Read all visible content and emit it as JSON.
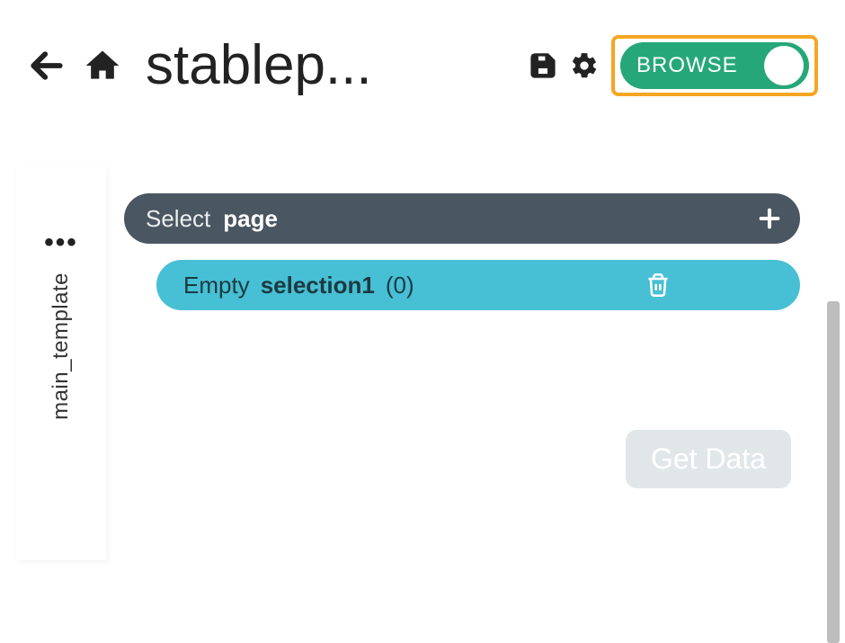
{
  "header": {
    "title": "stablep...",
    "toggle_label": "BROWSE"
  },
  "sidebar": {
    "tab_label": "main_template"
  },
  "rows": {
    "select": {
      "prefix": "Select",
      "target": "page"
    },
    "selection": {
      "status": "Empty",
      "name": "selection1",
      "count": "(0)"
    }
  },
  "actions": {
    "get_data": "Get Data"
  }
}
